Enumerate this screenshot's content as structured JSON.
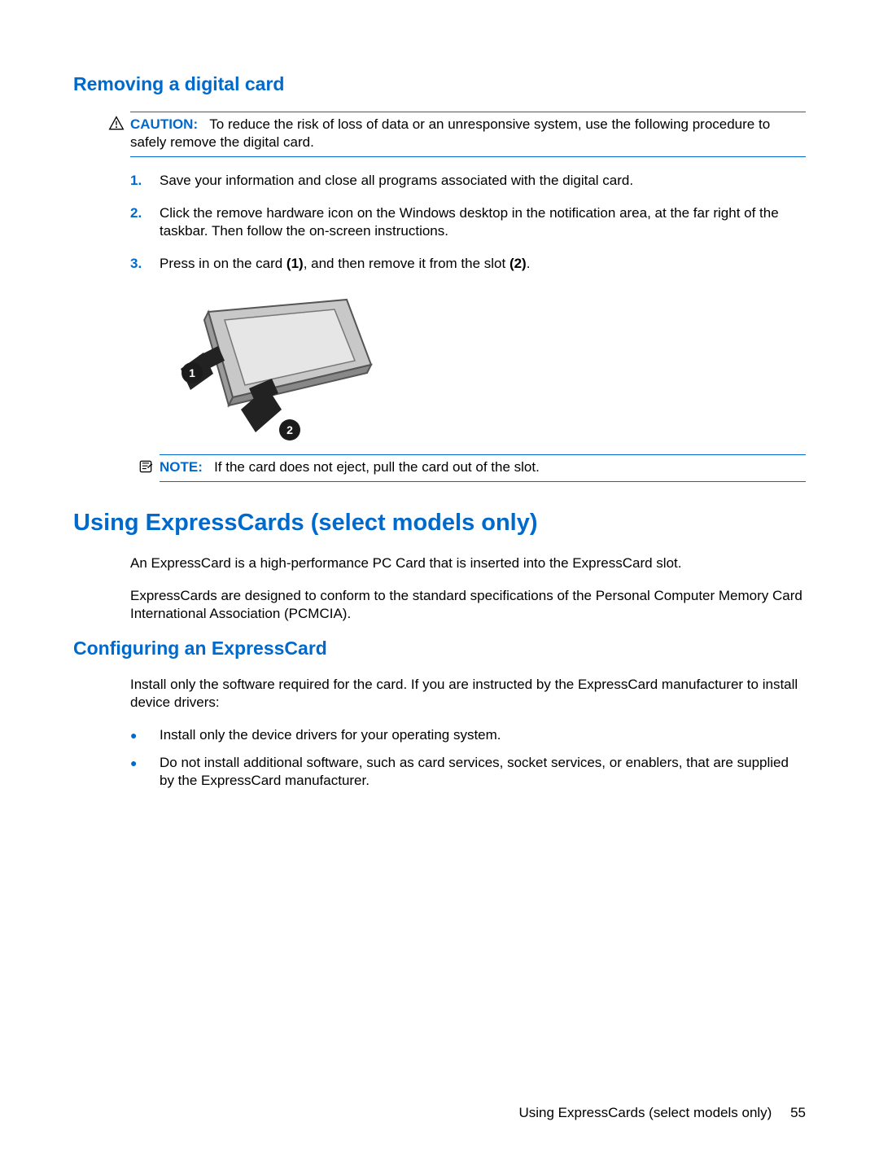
{
  "section1": {
    "heading": "Removing a digital card",
    "caution_label": "CAUTION:",
    "caution_text": "To reduce the risk of loss of data or an unresponsive system, use the following procedure to safely remove the digital card.",
    "steps": [
      {
        "n": "1.",
        "text": "Save your information and close all programs associated with the digital card."
      },
      {
        "n": "2.",
        "text": "Click the remove hardware icon on the Windows desktop in the notification area, at the far right of the taskbar. Then follow the on-screen instructions."
      },
      {
        "n": "3.",
        "pre": "Press in on the card ",
        "b1": "(1)",
        "mid": ", and then remove it from the slot ",
        "b2": "(2)",
        "post": "."
      }
    ],
    "note_label": "NOTE:",
    "note_text": "If the card does not eject, pull the card out of the slot."
  },
  "section2": {
    "heading": "Using ExpressCards (select models only)",
    "para1": "An ExpressCard is a high-performance PC Card that is inserted into the ExpressCard slot.",
    "para2": "ExpressCards are designed to conform to the standard specifications of the Personal Computer Memory Card International Association (PCMCIA).",
    "sub_heading": "Configuring an ExpressCard",
    "para3": "Install only the software required for the card. If you are instructed by the ExpressCard manufacturer to install device drivers:",
    "bullets": [
      "Install only the device drivers for your operating system.",
      "Do not install additional software, such as card services, socket services, or enablers, that are supplied by the ExpressCard manufacturer."
    ]
  },
  "footer": {
    "text": "Using ExpressCards (select models only)",
    "page": "55"
  }
}
